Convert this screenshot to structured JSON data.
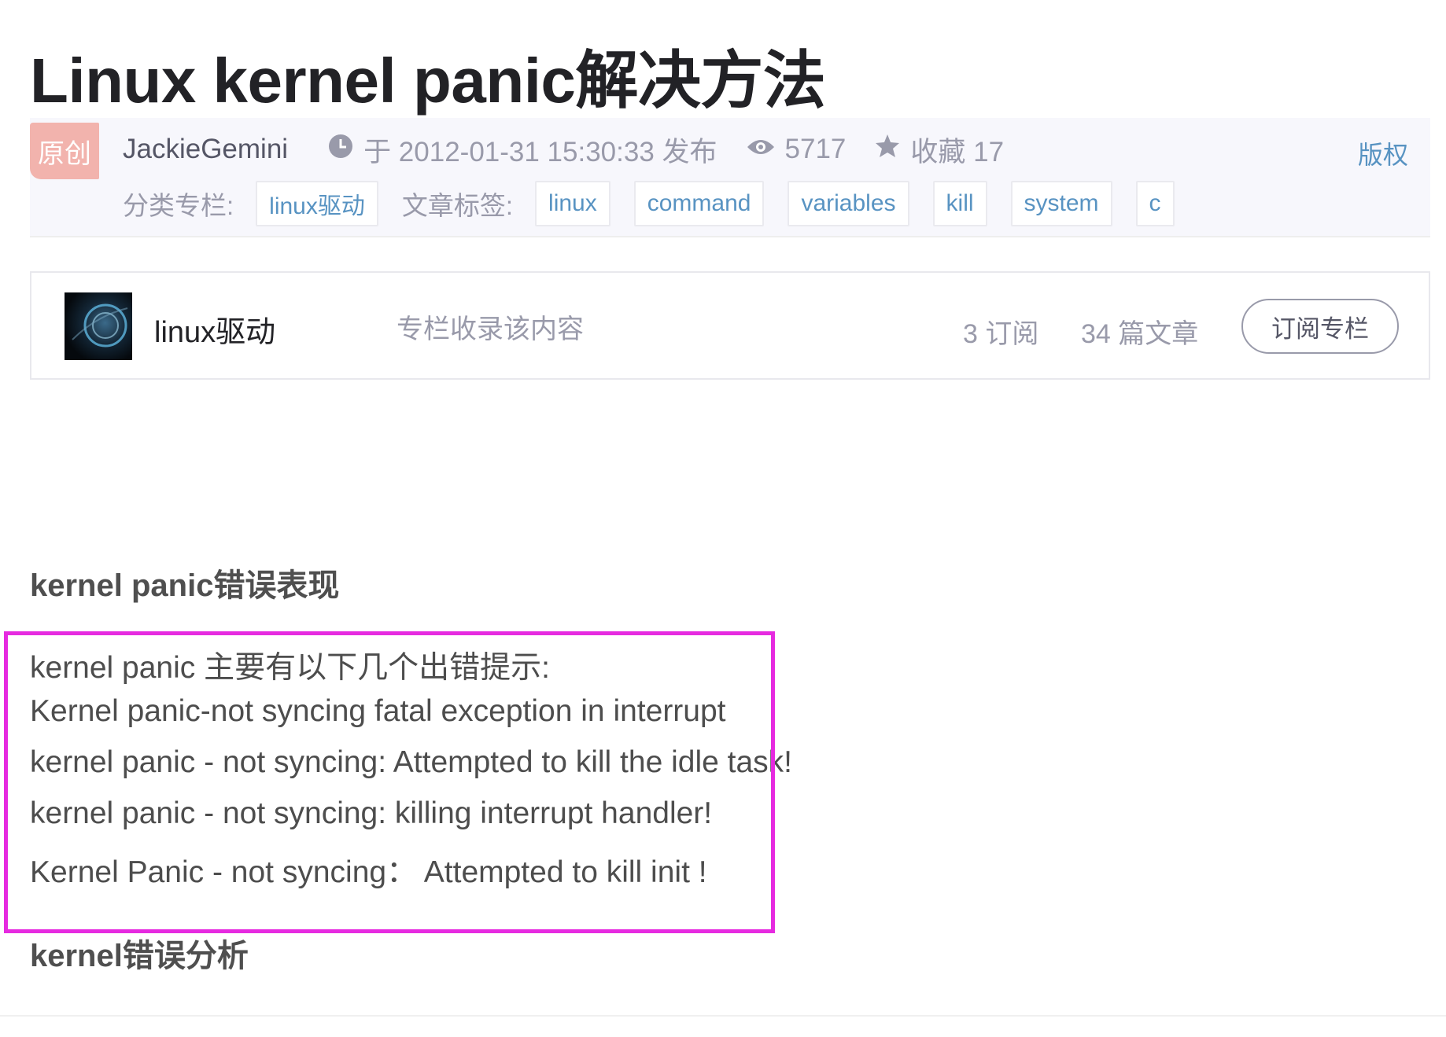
{
  "article": {
    "title": "Linux kernel panic解决方法",
    "badge": "原创",
    "author": "JackieGemini",
    "publish_time": "于 2012-01-31 15:30:33 发布",
    "views": "5717",
    "favorites": "收藏 17",
    "copyright": "版权",
    "category_label": "分类专栏:",
    "category": "linux驱动",
    "tags_label": "文章标签:",
    "tags": [
      "linux",
      "command",
      "variables",
      "kill",
      "system",
      "c"
    ]
  },
  "column": {
    "name": "linux驱动",
    "description": "专栏收录该内容",
    "subscribers": "3 订阅",
    "articles": "34 篇文章",
    "subscribe_label": "订阅专栏"
  },
  "content": {
    "heading1": "kernel panic错误表现",
    "lines": [
      "kernel panic 主要有以下几个出错提示:",
      "Kernel panic-not syncing fatal exception in interrupt",
      "kernel panic - not syncing: Attempted to kill the idle task!",
      "kernel panic - not syncing: killing interrupt handler!",
      "Kernel Panic - not syncing： Attempted to kill init !"
    ],
    "heading2": "kernel错误分析"
  },
  "colors": {
    "highlight": "#e62ae0",
    "badge": "#f2b3ad",
    "link": "#5893c2"
  }
}
